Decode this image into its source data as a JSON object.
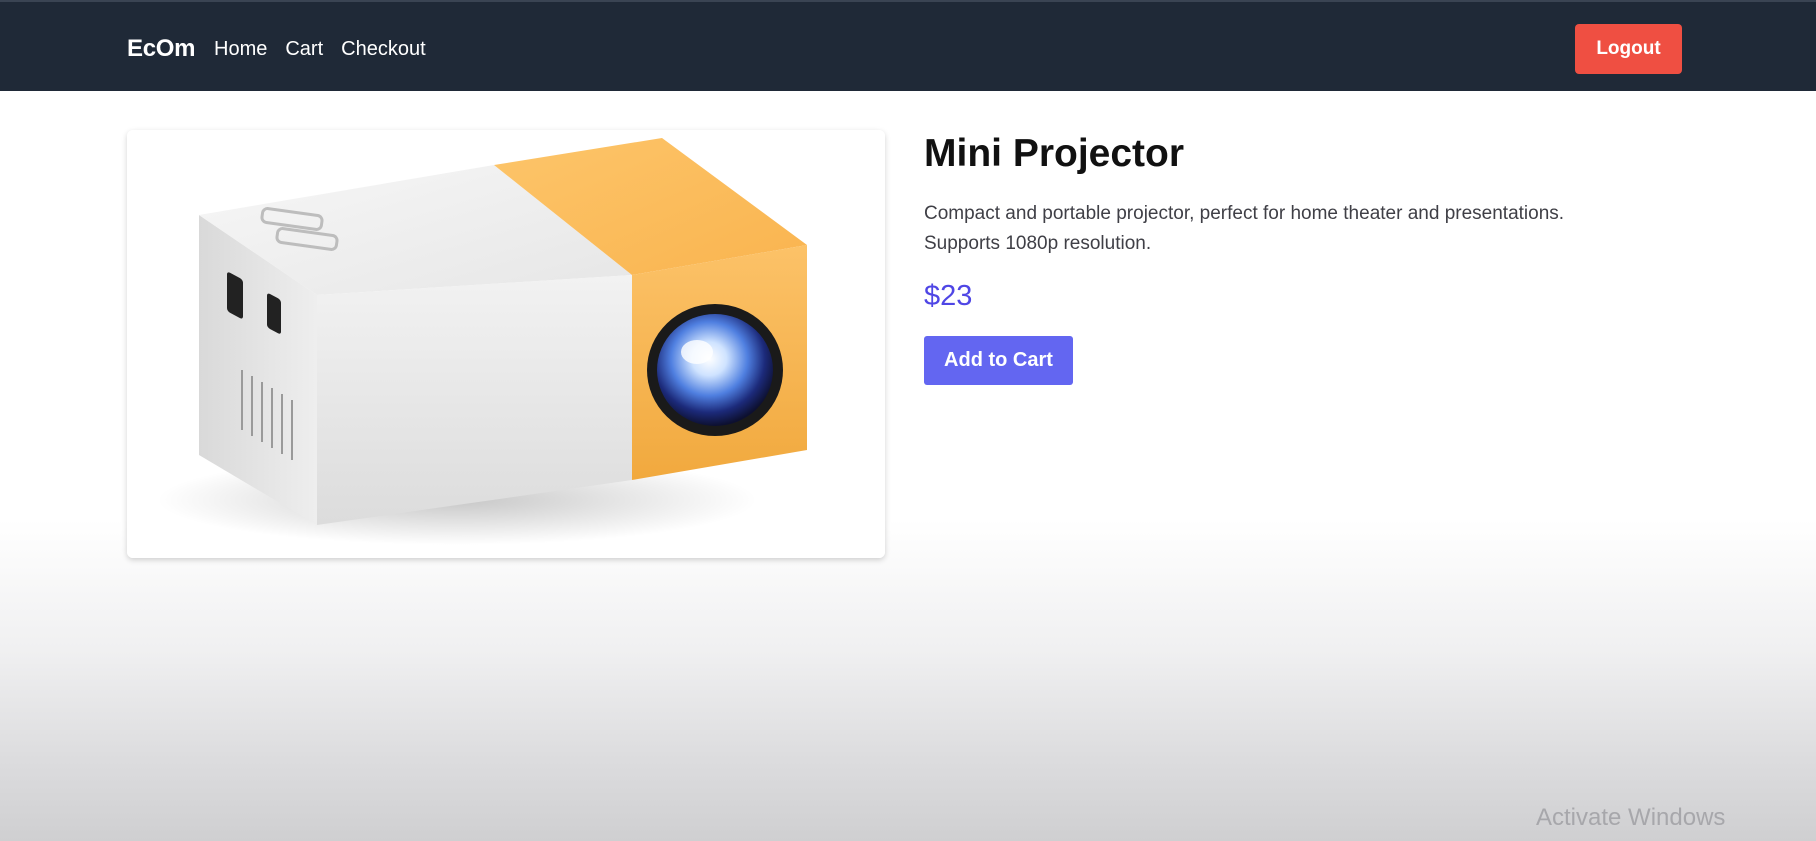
{
  "navbar": {
    "brand": "EcOm",
    "links": [
      {
        "label": "Home"
      },
      {
        "label": "Cart"
      },
      {
        "label": "Checkout"
      }
    ],
    "logout_label": "Logout"
  },
  "product": {
    "title": "Mini Projector",
    "description": "Compact and portable projector, perfect for home theater and presentations. Supports 1080p resolution.",
    "price": "$23",
    "add_to_cart_label": "Add to Cart",
    "image_alt": "mini-projector-image"
  },
  "watermark": "Activate Windows",
  "colors": {
    "navbar_bg": "#1f2937",
    "logout_bg": "#ef4f42",
    "price": "#4f46e5",
    "add_button_bg": "#6366f1",
    "projector_accent": "#fcbd5a"
  }
}
